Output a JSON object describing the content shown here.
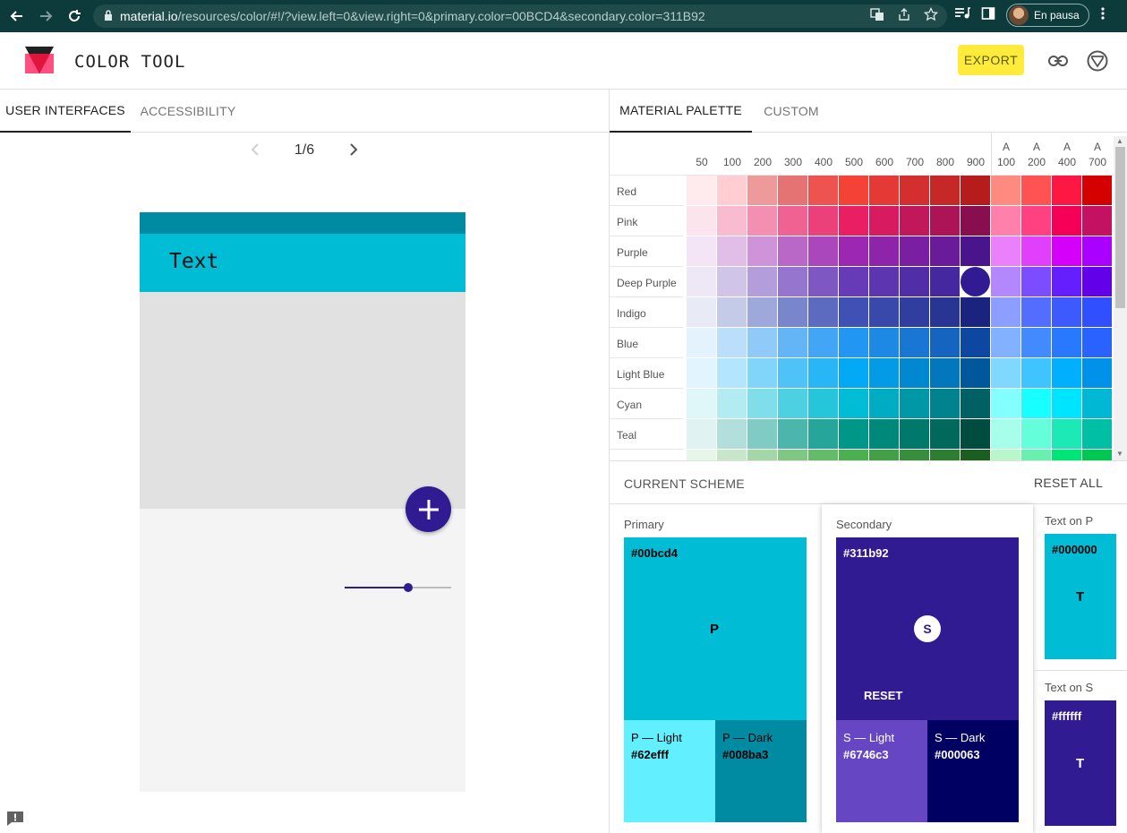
{
  "browser": {
    "url_host": "material.io",
    "url_rest": "/resources/color/#!/?view.left=0&view.right=0&primary.color=00BCD4&secondary.color=311B92",
    "profile_label": "En pausa"
  },
  "app": {
    "title": "COLOR TOOL",
    "export_label": "EXPORT"
  },
  "left": {
    "tabs": [
      {
        "label": "USER INTERFACES",
        "active": true
      },
      {
        "label": "ACCESSIBILITY",
        "active": false
      }
    ],
    "pager": "1/6",
    "preview": {
      "title": "Text",
      "slider_value": 0.6
    }
  },
  "right": {
    "tabs": [
      {
        "label": "MATERIAL PALETTE",
        "active": true
      },
      {
        "label": "CUSTOM",
        "active": false
      }
    ],
    "palette": {
      "shades": [
        {
          "line1": "",
          "line2": "50"
        },
        {
          "line1": "",
          "line2": "100"
        },
        {
          "line1": "",
          "line2": "200"
        },
        {
          "line1": "",
          "line2": "300"
        },
        {
          "line1": "",
          "line2": "400"
        },
        {
          "line1": "",
          "line2": "500"
        },
        {
          "line1": "",
          "line2": "600"
        },
        {
          "line1": "",
          "line2": "700"
        },
        {
          "line1": "",
          "line2": "800"
        },
        {
          "line1": "",
          "line2": "900"
        },
        {
          "line1": "A",
          "line2": "100"
        },
        {
          "line1": "A",
          "line2": "200"
        },
        {
          "line1": "A",
          "line2": "400"
        },
        {
          "line1": "A",
          "line2": "700"
        }
      ],
      "selected": {
        "row": "Deep Purple",
        "shade": "900"
      },
      "rows": [
        {
          "name": "Red",
          "colors": [
            "#ffebee",
            "#ffcdd2",
            "#ef9a9a",
            "#e57373",
            "#ef5350",
            "#f44336",
            "#e53935",
            "#d32f2f",
            "#c62828",
            "#b71c1c",
            "#ff8a80",
            "#ff5252",
            "#ff1744",
            "#d50000"
          ]
        },
        {
          "name": "Pink",
          "colors": [
            "#fce4ec",
            "#f8bbd0",
            "#f48fb1",
            "#f06292",
            "#ec407a",
            "#e91e63",
            "#d81b60",
            "#c2185b",
            "#ad1457",
            "#880e4f",
            "#ff80ab",
            "#ff4081",
            "#f50057",
            "#c51162"
          ]
        },
        {
          "name": "Purple",
          "colors": [
            "#f3e5f5",
            "#e1bee7",
            "#ce93d8",
            "#ba68c8",
            "#ab47bc",
            "#9c27b0",
            "#8e24aa",
            "#7b1fa2",
            "#6a1b9a",
            "#4a148c",
            "#ea80fc",
            "#e040fb",
            "#d500f9",
            "#aa00ff"
          ]
        },
        {
          "name": "Deep Purple",
          "colors": [
            "#ede7f6",
            "#d1c4e9",
            "#b39ddb",
            "#9575cd",
            "#7e57c2",
            "#673ab7",
            "#5e35b1",
            "#512da8",
            "#4527a0",
            "#311b92",
            "#b388ff",
            "#7c4dff",
            "#651fff",
            "#6200ea"
          ]
        },
        {
          "name": "Indigo",
          "colors": [
            "#e8eaf6",
            "#c5cae9",
            "#9fa8da",
            "#7986cb",
            "#5c6bc0",
            "#3f51b5",
            "#3949ab",
            "#303f9f",
            "#283593",
            "#1a237e",
            "#8c9eff",
            "#536dfe",
            "#3d5afe",
            "#304ffe"
          ]
        },
        {
          "name": "Blue",
          "colors": [
            "#e3f2fd",
            "#bbdefb",
            "#90caf9",
            "#64b5f6",
            "#42a5f5",
            "#2196f3",
            "#1e88e5",
            "#1976d2",
            "#1565c0",
            "#0d47a1",
            "#82b1ff",
            "#448aff",
            "#2979ff",
            "#2962ff"
          ]
        },
        {
          "name": "Light Blue",
          "colors": [
            "#e1f5fe",
            "#b3e5fc",
            "#81d4fa",
            "#4fc3f7",
            "#29b6f6",
            "#03a9f4",
            "#039be5",
            "#0288d1",
            "#0277bd",
            "#01579b",
            "#80d8ff",
            "#40c4ff",
            "#00b0ff",
            "#0091ea"
          ]
        },
        {
          "name": "Cyan",
          "colors": [
            "#e0f7fa",
            "#b2ebf2",
            "#80deea",
            "#4dd0e1",
            "#26c6da",
            "#00bcd4",
            "#00acc1",
            "#0097a7",
            "#00838f",
            "#006064",
            "#84ffff",
            "#18ffff",
            "#00e5ff",
            "#00b8d4"
          ]
        },
        {
          "name": "Teal",
          "colors": [
            "#e0f2f1",
            "#b2dfdb",
            "#80cbc4",
            "#4db6ac",
            "#26a69a",
            "#009688",
            "#00897b",
            "#00796b",
            "#00695c",
            "#004d40",
            "#a7ffeb",
            "#64ffda",
            "#1de9b6",
            "#00bfa5"
          ]
        },
        {
          "name": "",
          "colors": [
            "#e8f5e9",
            "#c8e6c9",
            "#a5d6a7",
            "#81c784",
            "#66bb6a",
            "#4caf50",
            "#43a047",
            "#388e3c",
            "#2e7d32",
            "#1b5e20",
            "#b9f6ca",
            "#69f0ae",
            "#00e676",
            "#00c853"
          ]
        }
      ]
    },
    "scheme": {
      "label": "CURRENT SCHEME",
      "reset_all": "RESET ALL",
      "primary": {
        "label": "Primary",
        "hex": "#00bcd4",
        "badge": "P",
        "light_label": "P — Light",
        "light_hex": "#62efff",
        "dark_label": "P — Dark",
        "dark_hex": "#008ba3"
      },
      "secondary": {
        "label": "Secondary",
        "hex": "#311b92",
        "badge": "S",
        "reset": "RESET",
        "light_label": "S — Light",
        "light_hex": "#6746c3",
        "dark_label": "S — Dark",
        "dark_hex": "#000063"
      },
      "text_on_p": {
        "label": "Text on P",
        "hex": "#000000",
        "badge": "T"
      },
      "text_on_s": {
        "label": "Text on S",
        "hex": "#ffffff",
        "badge": "T"
      }
    }
  },
  "colors": {
    "primary": "#00bcd4",
    "primary_dark": "#008ba3",
    "primary_light": "#62efff",
    "secondary": "#311b92",
    "secondary_light": "#6746c3",
    "secondary_dark": "#000063",
    "export_highlight": "#ffeb3b"
  }
}
